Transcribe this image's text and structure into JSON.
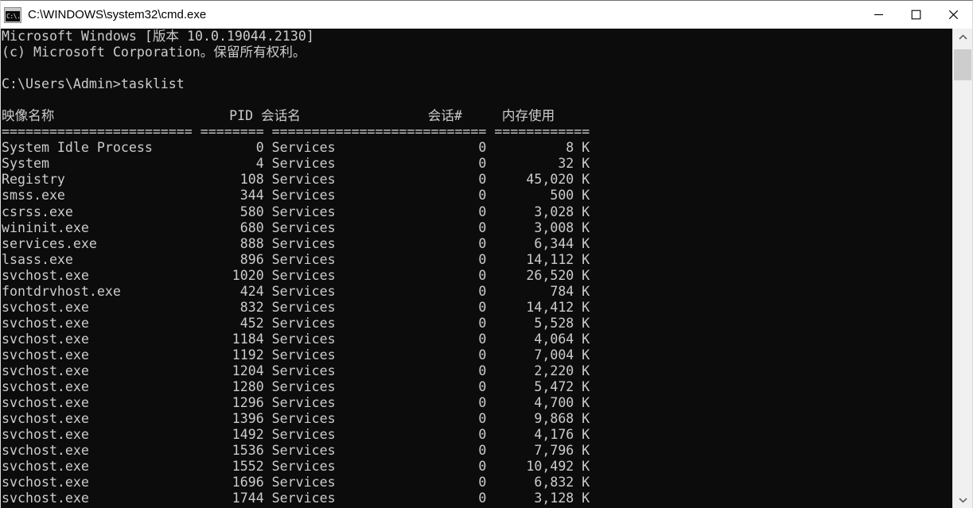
{
  "window": {
    "title": "C:\\WINDOWS\\system32\\cmd.exe",
    "icon": "cmd-console-icon",
    "icon_glyph": "C:\\.",
    "background": "#0c0c0c",
    "foreground": "#cccccc",
    "titlebar_background": "#ffffff",
    "controls": {
      "minimize_label": "Minimize",
      "maximize_label": "Maximize",
      "close_label": "Close"
    }
  },
  "scrollbar": {
    "up_arrow": "scroll-up",
    "down_arrow": "scroll-down",
    "thumb_label": "scroll-thumb",
    "thumb_color": "#cdcdcd",
    "track_color": "#f0f0f0"
  },
  "console": {
    "banner": [
      "Microsoft Windows [版本 10.0.19044.2130]",
      "(c) Microsoft Corporation。保留所有权利。"
    ],
    "prompt": "C:\\Users\\Admin>",
    "command": "tasklist",
    "table": {
      "headers": [
        "映像名称",
        "PID",
        "会话名",
        "会话#",
        "内存使用"
      ],
      "separators": [
        "========================",
        "========",
        "================",
        "===========",
        "============"
      ],
      "rows": [
        {
          "image": "System Idle Process",
          "pid": "0",
          "session_name": "Services",
          "session_num": "0",
          "mem": "8 K"
        },
        {
          "image": "System",
          "pid": "4",
          "session_name": "Services",
          "session_num": "0",
          "mem": "32 K"
        },
        {
          "image": "Registry",
          "pid": "108",
          "session_name": "Services",
          "session_num": "0",
          "mem": "45,020 K"
        },
        {
          "image": "smss.exe",
          "pid": "344",
          "session_name": "Services",
          "session_num": "0",
          "mem": "500 K"
        },
        {
          "image": "csrss.exe",
          "pid": "580",
          "session_name": "Services",
          "session_num": "0",
          "mem": "3,028 K"
        },
        {
          "image": "wininit.exe",
          "pid": "680",
          "session_name": "Services",
          "session_num": "0",
          "mem": "3,008 K"
        },
        {
          "image": "services.exe",
          "pid": "888",
          "session_name": "Services",
          "session_num": "0",
          "mem": "6,344 K"
        },
        {
          "image": "lsass.exe",
          "pid": "896",
          "session_name": "Services",
          "session_num": "0",
          "mem": "14,112 K"
        },
        {
          "image": "svchost.exe",
          "pid": "1020",
          "session_name": "Services",
          "session_num": "0",
          "mem": "26,520 K"
        },
        {
          "image": "fontdrvhost.exe",
          "pid": "424",
          "session_name": "Services",
          "session_num": "0",
          "mem": "784 K"
        },
        {
          "image": "svchost.exe",
          "pid": "832",
          "session_name": "Services",
          "session_num": "0",
          "mem": "14,412 K"
        },
        {
          "image": "svchost.exe",
          "pid": "452",
          "session_name": "Services",
          "session_num": "0",
          "mem": "5,528 K"
        },
        {
          "image": "svchost.exe",
          "pid": "1184",
          "session_name": "Services",
          "session_num": "0",
          "mem": "4,064 K"
        },
        {
          "image": "svchost.exe",
          "pid": "1192",
          "session_name": "Services",
          "session_num": "0",
          "mem": "7,004 K"
        },
        {
          "image": "svchost.exe",
          "pid": "1204",
          "session_name": "Services",
          "session_num": "0",
          "mem": "2,220 K"
        },
        {
          "image": "svchost.exe",
          "pid": "1280",
          "session_name": "Services",
          "session_num": "0",
          "mem": "5,472 K"
        },
        {
          "image": "svchost.exe",
          "pid": "1296",
          "session_name": "Services",
          "session_num": "0",
          "mem": "4,700 K"
        },
        {
          "image": "svchost.exe",
          "pid": "1396",
          "session_name": "Services",
          "session_num": "0",
          "mem": "9,868 K"
        },
        {
          "image": "svchost.exe",
          "pid": "1492",
          "session_name": "Services",
          "session_num": "0",
          "mem": "4,176 K"
        },
        {
          "image": "svchost.exe",
          "pid": "1536",
          "session_name": "Services",
          "session_num": "0",
          "mem": "7,796 K"
        },
        {
          "image": "svchost.exe",
          "pid": "1552",
          "session_name": "Services",
          "session_num": "0",
          "mem": "10,492 K"
        },
        {
          "image": "svchost.exe",
          "pid": "1696",
          "session_name": "Services",
          "session_num": "0",
          "mem": "6,832 K"
        },
        {
          "image": "svchost.exe",
          "pid": "1744",
          "session_name": "Services",
          "session_num": "0",
          "mem": "3,128 K"
        }
      ]
    }
  }
}
